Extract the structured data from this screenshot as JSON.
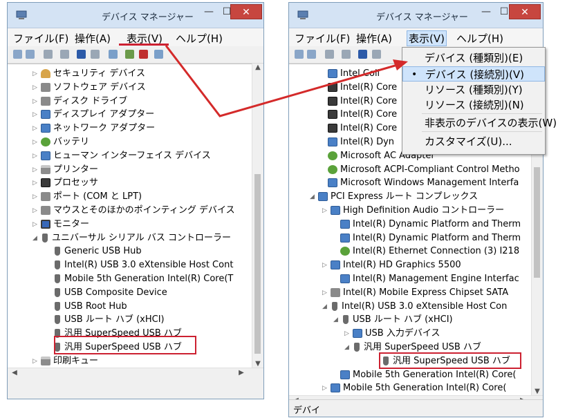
{
  "left_window": {
    "title": "デバイス マネージャー",
    "menu": [
      "ファイル(F)",
      "操作(A)",
      "表示(V)",
      "ヘルプ(H)"
    ],
    "tree": [
      {
        "exp": "▷",
        "icon": "key",
        "label": "セキュリティ デバイス"
      },
      {
        "exp": "▷",
        "icon": "gray",
        "label": "ソフトウェア デバイス"
      },
      {
        "exp": "▷",
        "icon": "gray",
        "label": "ディスク ドライブ"
      },
      {
        "exp": "▷",
        "icon": "dev",
        "label": "ディスプレイ アダプター"
      },
      {
        "exp": "▷",
        "icon": "dev",
        "label": "ネットワーク アダプター"
      },
      {
        "exp": "▷",
        "icon": "green",
        "label": "バッテリ"
      },
      {
        "exp": "▷",
        "icon": "dev",
        "label": "ヒューマン インターフェイス デバイス"
      },
      {
        "exp": "▷",
        "icon": "print",
        "label": "プリンター"
      },
      {
        "exp": "▷",
        "icon": "chip",
        "label": "プロセッサ"
      },
      {
        "exp": "▷",
        "icon": "gray",
        "label": "ポート (COM と LPT)"
      },
      {
        "exp": "▷",
        "icon": "gray",
        "label": "マウスとそのほかのポインティング デバイス"
      },
      {
        "exp": "▷",
        "icon": "mon",
        "label": "モニター"
      },
      {
        "exp": "◢",
        "icon": "usb",
        "label": "ユニバーサル シリアル バス コントローラー"
      },
      {
        "exp": "",
        "icon": "usb",
        "label": "Generic USB Hub"
      },
      {
        "exp": "",
        "icon": "usb",
        "label": "Intel(R) USB 3.0 eXtensible Host Cont"
      },
      {
        "exp": "",
        "icon": "usb",
        "label": "Mobile 5th Generation Intel(R) Core(T"
      },
      {
        "exp": "",
        "icon": "usb",
        "label": "USB Composite Device"
      },
      {
        "exp": "",
        "icon": "usb",
        "label": "USB Root Hub"
      },
      {
        "exp": "",
        "icon": "usb",
        "label": "USB ルート ハブ (xHCI)"
      },
      {
        "exp": "",
        "icon": "usb",
        "label": "汎用 SuperSpeed USB ハブ"
      },
      {
        "exp": "",
        "icon": "usb",
        "label": "汎用 SuperSpeed USB ハブ"
      },
      {
        "exp": "▷",
        "icon": "print",
        "label": "印刷キュー"
      }
    ]
  },
  "right_window": {
    "title": "デバイス マネージャー",
    "menu": [
      "ファイル(F)",
      "操作(A)",
      "表示(V)",
      "ヘルプ(H)"
    ],
    "status_text": "デバイ",
    "view_menu": [
      {
        "label": "デバイス (種類別)(E)",
        "checked": false,
        "highlighted": false
      },
      {
        "label": "デバイス (接続別)(V)",
        "checked": true,
        "highlighted": true
      },
      {
        "label": "リソース (種類別)(Y)",
        "checked": false,
        "highlighted": false
      },
      {
        "label": "リソース (接続別)(N)",
        "checked": false,
        "highlighted": false
      },
      {
        "label": "非表示のデバイスの表示(W)",
        "checked": false,
        "highlighted": false
      },
      {
        "label": "カスタマイズ(U)...",
        "checked": false,
        "highlighted": false
      }
    ],
    "tree": [
      {
        "exp": "",
        "icon": "dev",
        "label": "Intel Coll"
      },
      {
        "exp": "",
        "icon": "chip",
        "label": "Intel(R) Core"
      },
      {
        "exp": "",
        "icon": "chip",
        "label": "Intel(R) Core"
      },
      {
        "exp": "",
        "icon": "chip",
        "label": "Intel(R) Core"
      },
      {
        "exp": "",
        "icon": "chip",
        "label": "Intel(R) Core"
      },
      {
        "exp": "",
        "icon": "dev",
        "label": "Intel(R) Dyn"
      },
      {
        "exp": "",
        "icon": "green",
        "label": "Microsoft AC Adapter"
      },
      {
        "exp": "",
        "icon": "green",
        "label": "Microsoft ACPI-Compliant Control Metho"
      },
      {
        "exp": "",
        "icon": "dev",
        "label": "Microsoft Windows Management Interfa"
      },
      {
        "exp": "◢",
        "icon": "dev",
        "label": "PCI Express ルート コンプレックス"
      },
      {
        "exp": "▷",
        "icon": "dev",
        "label": "High Definition Audio コントローラー"
      },
      {
        "exp": "",
        "icon": "dev",
        "label": "Intel(R) Dynamic Platform and Therm"
      },
      {
        "exp": "",
        "icon": "dev",
        "label": "Intel(R) Dynamic Platform and Therm"
      },
      {
        "exp": "",
        "icon": "green",
        "label": "Intel(R) Ethernet Connection (3) I218"
      },
      {
        "exp": "▷",
        "icon": "dev",
        "label": "Intel(R) HD Graphics 5500"
      },
      {
        "exp": "",
        "icon": "dev",
        "label": "Intel(R) Management Engine Interfac"
      },
      {
        "exp": "▷",
        "icon": "gray",
        "label": "Intel(R) Mobile Express Chipset SATA"
      },
      {
        "exp": "◢",
        "icon": "usb",
        "label": "Intel(R) USB 3.0 eXtensible Host Con"
      },
      {
        "exp": "◢",
        "icon": "usb",
        "label": "USB ルート ハブ (xHCI)"
      },
      {
        "exp": "▷",
        "icon": "dev",
        "label": "USB 入力デバイス"
      },
      {
        "exp": "◢",
        "icon": "usb",
        "label": "汎用 SuperSpeed USB ハブ"
      },
      {
        "exp": "",
        "icon": "usb",
        "label": "汎用 SuperSpeed USB ハブ"
      },
      {
        "exp": "",
        "icon": "dev",
        "label": "Mobile 5th Generation Intel(R) Core("
      },
      {
        "exp": "▷",
        "icon": "dev",
        "label": "Mobile 5th Generation Intel(R) Core("
      }
    ]
  },
  "colors": {
    "highlight_red": "#cc2030",
    "arrow_red": "#d42a2a"
  }
}
